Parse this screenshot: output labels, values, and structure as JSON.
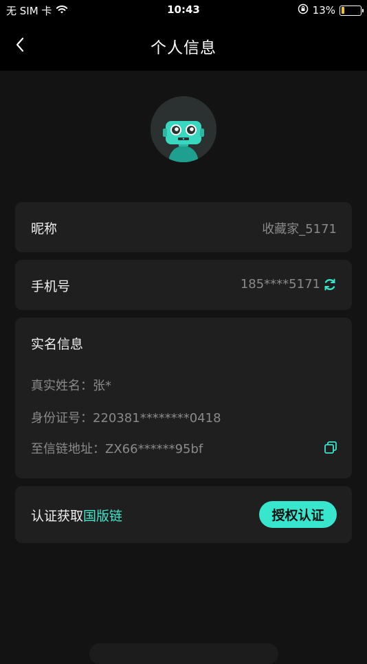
{
  "status_bar": {
    "carrier": "无 SIM 卡",
    "time": "10:43",
    "battery_percent": "13%",
    "battery_level": 0.13
  },
  "nav": {
    "title": "个人信息",
    "back_icon": "chevron-left-icon"
  },
  "avatar": {
    "icon": "robot-avatar"
  },
  "nickname": {
    "label": "昵称",
    "value": "收藏家_5171"
  },
  "phone": {
    "label": "手机号",
    "value": "185****5171",
    "icon": "refresh-icon"
  },
  "real_name": {
    "heading": "实名信息",
    "name_label": "真实姓名：",
    "name_value": "张*",
    "id_label": "身份证号：",
    "id_value": "220381********0418",
    "chain_label": "至信链地址：",
    "chain_value": "ZX66******95bf",
    "copy_icon": "copy-icon"
  },
  "auth": {
    "prefix": "认证获取",
    "chain_name": "国版链",
    "button_label": "授权认证"
  },
  "colors": {
    "accent": "#38e6cd",
    "background": "#131313",
    "card": "#1f1f1f"
  }
}
